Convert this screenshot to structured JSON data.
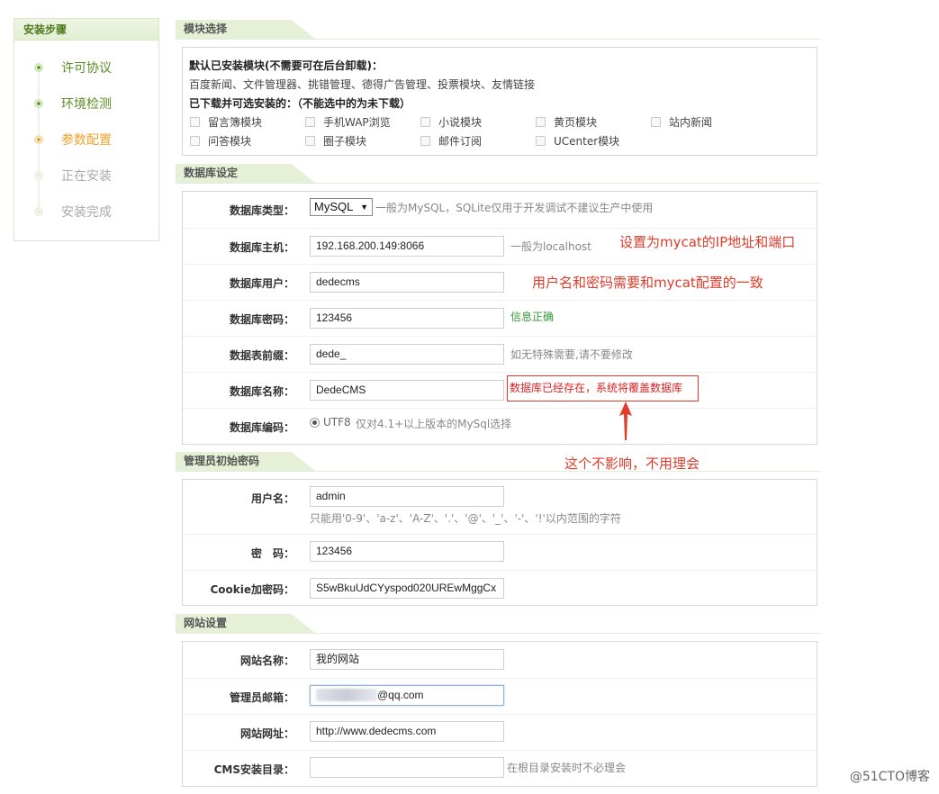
{
  "steps": {
    "title": "安装步骤",
    "items": [
      {
        "label": "许可协议",
        "state": "done"
      },
      {
        "label": "环境检测",
        "state": "done"
      },
      {
        "label": "参数配置",
        "state": "active"
      },
      {
        "label": "正在安装",
        "state": "pending"
      },
      {
        "label": "安装完成",
        "state": "pending"
      }
    ]
  },
  "modules": {
    "title": "模块选择",
    "installed_heading": "默认已安装模块(不需要可在后台卸载)：",
    "installed_list": "百度新闻、文件管理器、挑错管理、德得广告管理、投票模块、友情链接",
    "optional_heading": "已下载并可选安装的：（不能选中的为未下载）",
    "options": [
      "留言簿模块",
      "手机WAP浏览",
      "小说模块",
      "黄页模块",
      "站内新闻",
      "问答模块",
      "圈子模块",
      "邮件订阅",
      "UCenter模块"
    ]
  },
  "database": {
    "title": "数据库设定",
    "type_label": "数据库类型：",
    "type_value": "MySQL",
    "type_hint": "一般为MySQL，SQLite仅用于开发调试不建议生产中使用",
    "host_label": "数据库主机：",
    "host_value": "192.168.200.149:8066",
    "host_hint": "一般为localhost",
    "user_label": "数据库用户：",
    "user_value": "dedecms",
    "pwd_label": "数据库密码：",
    "pwd_value": "123456",
    "pwd_ok": "信息正确",
    "prefix_label": "数据表前缀：",
    "prefix_value": "dede_",
    "prefix_hint": "如无特殊需要,请不要修改",
    "name_label": "数据库名称：",
    "name_value": "DedeCMS",
    "name_warning": "数据库已经存在，系统将覆盖数据库",
    "charset_label": "数据库编码：",
    "charset_option": "UTF8",
    "charset_hint": "仅对4.1+以上版本的MySql选择"
  },
  "admin": {
    "title": "管理员初始密码",
    "user_label": "用户名：",
    "user_value": "admin",
    "user_hint": "只能用'0-9'、'a-z'、'A-Z'、'.'、'@'、'_'、'-'、'!'以内范围的字符",
    "pwd_label": "密　码：",
    "pwd_value": "123456",
    "cookie_label": "Cookie加密码：",
    "cookie_value": "S5wBkuUdCYyspod020UREwMggCx"
  },
  "site": {
    "title": "网站设置",
    "name_label": "网站名称：",
    "name_value": "我的网站",
    "email_label": "管理员邮箱：",
    "email_value": "@qq.com",
    "url_label": "网站网址：",
    "url_value": "http://www.dedecms.com",
    "dir_label": "CMS安装目录：",
    "dir_value": "",
    "dir_hint": "在根目录安装时不必理会"
  },
  "annotations": {
    "host_note": "设置为mycat的IP地址和端口",
    "user_note": "用户名和密码需要和mycat配置的一致",
    "ignore_note": "这个不影响，不用理会"
  },
  "watermark": "@51CTO博客",
  "colors": {
    "accent_green": "#5c8c23",
    "active_orange": "#f0a12c",
    "annotation_red": "#e23b2a"
  }
}
